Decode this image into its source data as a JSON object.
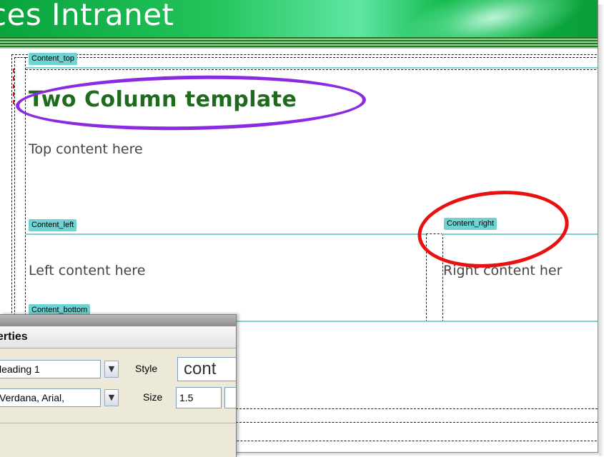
{
  "banner": {
    "title": "ces Intranet"
  },
  "regions": {
    "top": {
      "tag": "Content_top",
      "heading": "Two Column template",
      "text": "Top content here"
    },
    "left": {
      "tag": "Content_left",
      "text": "Left content here"
    },
    "right": {
      "tag": "Content_right",
      "text": "Right content her"
    },
    "bottom": {
      "tag": "Content_bottom"
    }
  },
  "annotations": {
    "purple_color": "#8a2be2",
    "red_color": "#e81010"
  },
  "properties": {
    "title": "erties",
    "format_value": "leading 1",
    "font_value": "Verdana, Arial,",
    "style_label": "Style",
    "style_value": "cont",
    "size_label": "Size",
    "size_value": "1.5"
  }
}
